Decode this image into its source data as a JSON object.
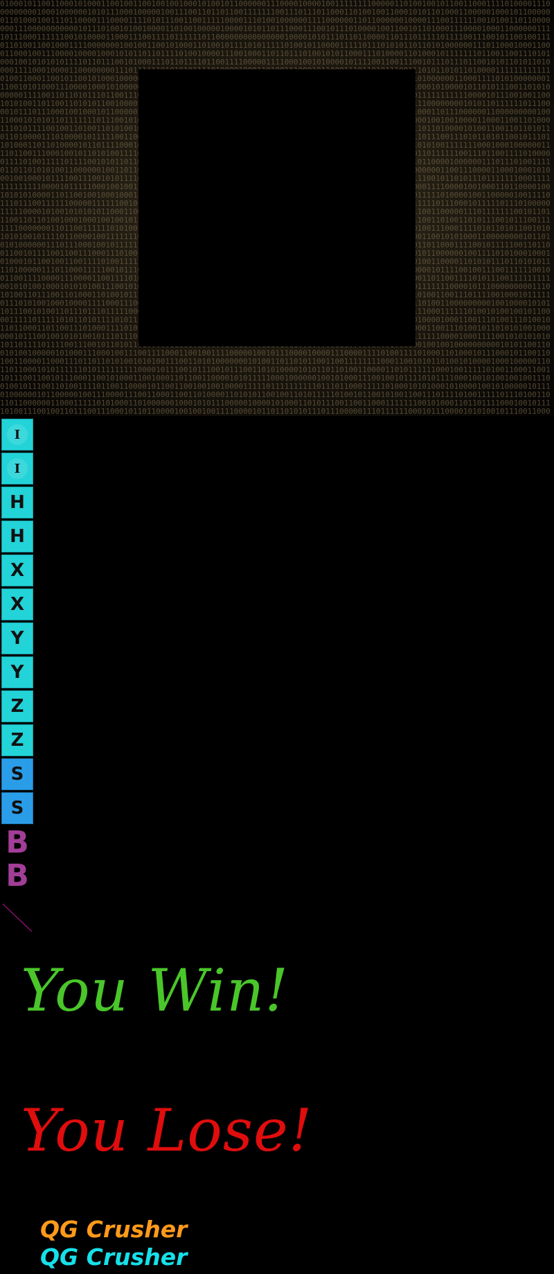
{
  "colors": {
    "piece_top": "#22d3d8",
    "piece_bottom": "#2a9de8",
    "bomb": "#a23e98",
    "win": "#4ac62a",
    "lose": "#e00d0d",
    "logo_orange": "#ff9a1a",
    "logo_cyan": "#16e0ea",
    "pointer_line": "#b0148a",
    "binary_text": "#8b7a56"
  },
  "pieces": [
    {
      "label": "I",
      "icon": "i-piece-icon"
    },
    {
      "label": "I",
      "icon": "i-piece-icon"
    },
    {
      "label": "H",
      "icon": "h-piece-icon"
    },
    {
      "label": "H",
      "icon": "h-piece-icon"
    },
    {
      "label": "X",
      "icon": "x-piece-icon"
    },
    {
      "label": "X",
      "icon": "x-piece-icon"
    },
    {
      "label": "Y",
      "icon": "y-piece-icon"
    },
    {
      "label": "Y",
      "icon": "y-piece-icon"
    },
    {
      "label": "Z",
      "icon": "z-piece-icon"
    },
    {
      "label": "Z",
      "icon": "z-piece-icon"
    },
    {
      "label": "S",
      "icon": "s-piece-icon"
    },
    {
      "label": "S",
      "icon": "s-piece-icon"
    }
  ],
  "bombs": [
    {
      "label": "B",
      "icon": "bomb-icon"
    },
    {
      "label": "B",
      "icon": "bomb-icon"
    }
  ],
  "messages": {
    "win": "You Win!",
    "lose": "You Lose!"
  },
  "logos": {
    "orange": "QG Crusher",
    "cyan": "QG Crusher"
  }
}
